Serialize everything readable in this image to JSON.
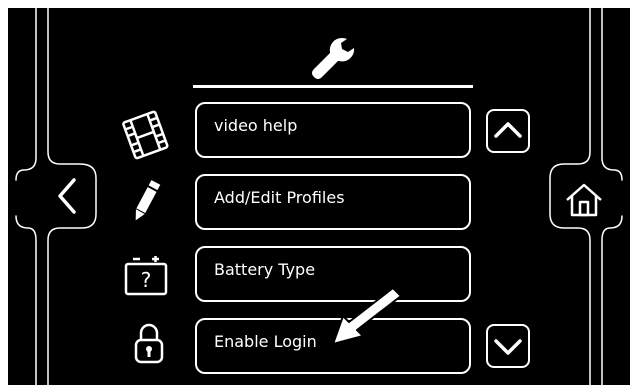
{
  "screen": {
    "title_icon": "wrench-icon",
    "menu": [
      {
        "label": "video help",
        "icon": "film-icon"
      },
      {
        "label": "Add/Edit Profiles",
        "icon": "pencil-icon"
      },
      {
        "label": "Battery Type",
        "icon": "battery-question-icon"
      },
      {
        "label": "Enable Login",
        "icon": "lock-icon"
      }
    ],
    "nav": {
      "back_icon": "chevron-left-icon",
      "home_icon": "home-icon",
      "scroll_up_icon": "chevron-up-icon",
      "scroll_down_icon": "chevron-down-icon"
    },
    "annotation_icon": "pointer-arrow-icon",
    "colors": {
      "background": "#000000",
      "foreground": "#ffffff"
    }
  }
}
